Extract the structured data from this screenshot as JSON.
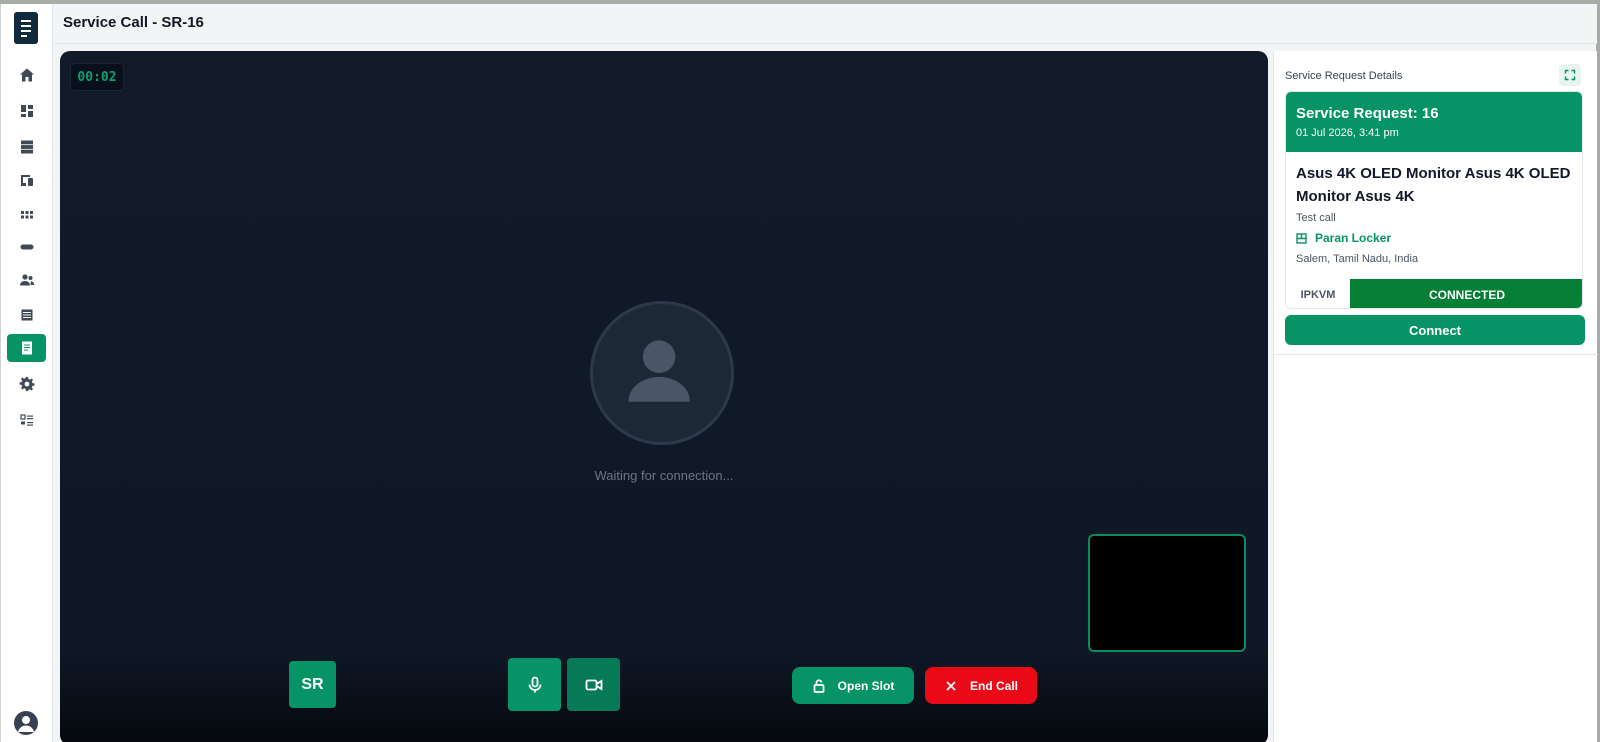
{
  "header": {
    "title": "Service Call - SR-16"
  },
  "sidebar": {
    "items": [
      {
        "icon": "home-icon"
      },
      {
        "icon": "dashboard-icon"
      },
      {
        "icon": "storage-icon"
      },
      {
        "icon": "devices-icon"
      },
      {
        "icon": "apps-grid-icon"
      },
      {
        "icon": "controller-icon"
      },
      {
        "icon": "users-icon"
      },
      {
        "icon": "table-icon"
      },
      {
        "icon": "document-icon",
        "active": true
      },
      {
        "icon": "gear-icon"
      },
      {
        "icon": "list-icon"
      }
    ],
    "profile_icon": "user-profile-icon"
  },
  "video": {
    "timer": "00:02",
    "waiting_text": "Waiting for connection...",
    "participant_initials": "SR",
    "open_slot_label": "Open Slot",
    "end_call_label": "End Call"
  },
  "panel": {
    "title": "Service Request Details",
    "request_title": "Service Request: 16",
    "request_date": "01 Jul 2026, 3:41 pm",
    "product": "Asus 4K OLED Monitor Asus 4K OLED Monitor Asus 4K",
    "description": "Test call",
    "location_name": "Paran Locker",
    "address": "Salem, Tamil Nadu, India",
    "device_label": "IPKVM",
    "device_status": "CONNECTED",
    "connect_label": "Connect"
  },
  "colors": {
    "accent": "#069466",
    "status_connected": "#057f35",
    "danger": "#ea0a17",
    "video_bg": "#101827"
  }
}
